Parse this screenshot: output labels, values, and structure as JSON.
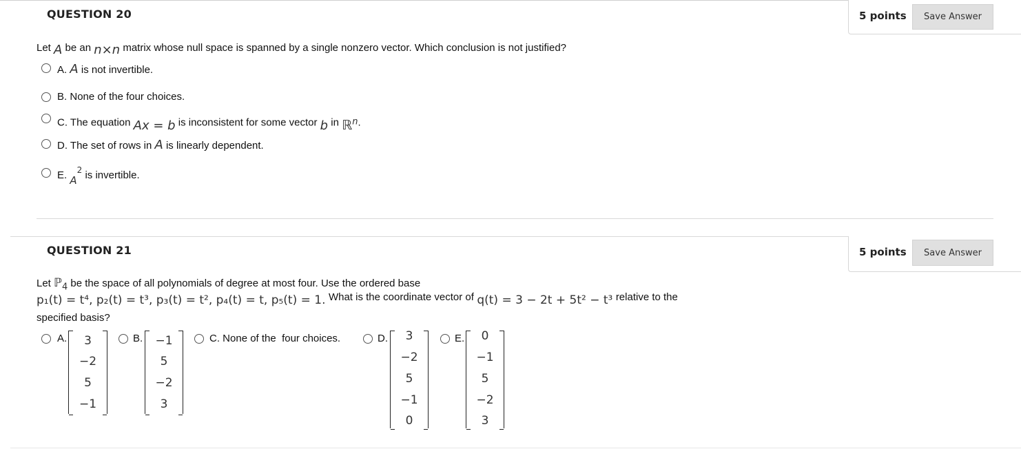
{
  "q20": {
    "title": "QUESTION 20",
    "points": "5 points",
    "save_label": "Save Answer",
    "prompt": {
      "let": "Let",
      "A": "A",
      "be_an": "be an",
      "nxn": "n×n",
      "rest": "matrix whose null space is spanned by a single nonzero vector. Which conclusion is not justified?"
    },
    "options": {
      "a": {
        "letter": "A.",
        "math": "A",
        "text": "is not invertible."
      },
      "b": {
        "letter": "B.",
        "text": "None of the four choices."
      },
      "c": {
        "letter": "C.",
        "text1": "The equation",
        "math1": "Ax = b",
        "text2": "is inconsistent for some vector",
        "math2": "b",
        "text3": "in",
        "math3": "ℝ",
        "sup": "n",
        "end": "."
      },
      "d": {
        "letter": "D.",
        "text1": "The set of rows in",
        "math": "A",
        "text2": "is linearly dependent."
      },
      "e": {
        "letter": "E.",
        "math": "A",
        "sup": "2",
        "text": "is invertible."
      }
    }
  },
  "q21": {
    "title": "QUESTION 21",
    "points": "5 points",
    "save_label": "Save Answer",
    "prompt": {
      "let": "Let",
      "P": "ℙ",
      "P_sub": "4",
      "line1_rest": "be the space of all polynomials of degree at most four. Use the ordered base",
      "basis": "p₁(t) = t⁴, p₂(t) = t³, p₃(t) = t², p₄(t) = t, p₅(t) = 1.",
      "what": "What is the coordinate vector of",
      "q": "q(t) = 3 − 2t + 5t² − t³",
      "relative": "relative to the",
      "line3": "specified basis?"
    },
    "options": {
      "a": {
        "letter": "A.",
        "vector": [
          "3",
          "−2",
          "5",
          "−1"
        ]
      },
      "b": {
        "letter": "B.",
        "vector": [
          "−1",
          "5",
          "−2",
          "3"
        ]
      },
      "c": {
        "letter": "C.",
        "text": "None of the  four choices."
      },
      "d": {
        "letter": "D.",
        "vector": [
          "3",
          "−2",
          "5",
          "−1",
          "0"
        ]
      },
      "e": {
        "letter": "E.",
        "vector": [
          "0",
          "−1",
          "5",
          "−2",
          "3"
        ]
      }
    }
  }
}
